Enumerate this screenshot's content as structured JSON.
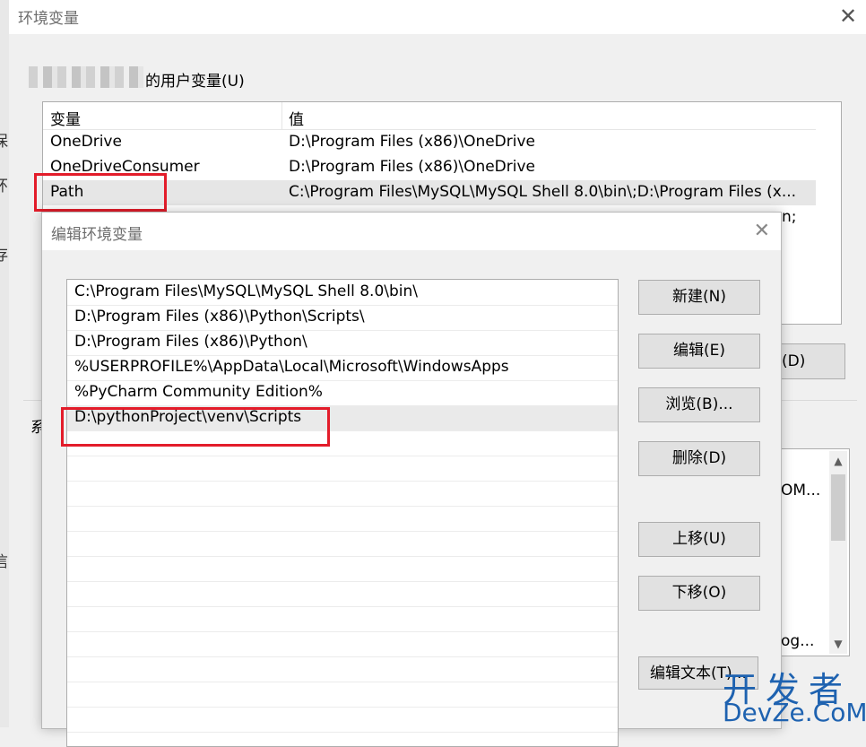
{
  "outer_dialog": {
    "title": "环境变量",
    "close_glyph": "✕",
    "user_vars_label": "的用户变量(U)",
    "columns": {
      "variable": "变量",
      "value": "值"
    },
    "rows": [
      {
        "name": "OneDrive",
        "value": "D:\\Program Files (x86)\\OneDrive"
      },
      {
        "name": "OneDriveConsumer",
        "value": "D:\\Program Files (x86)\\OneDrive"
      },
      {
        "name": "Path",
        "value": "C:\\Program Files\\MySQL\\MySQL Shell 8.0\\bin\\;D:\\Program Files (x..."
      }
    ],
    "partial_row_fragment": "n;",
    "partial_delete_button": "(D)",
    "system_vars_label_fragment": "系",
    "system_list_fragment_1": "OM...",
    "system_list_fragment_2": "og...",
    "left_fragments": [
      "保",
      "环",
      "存",
      "信"
    ]
  },
  "edit_dialog": {
    "title": "编辑环境变量",
    "close_glyph": "✕",
    "entries": [
      "C:\\Program Files\\MySQL\\MySQL Shell 8.0\\bin\\",
      "D:\\Program Files (x86)\\Python\\Scripts\\",
      "D:\\Program Files (x86)\\Python\\",
      "%USERPROFILE%\\AppData\\Local\\Microsoft\\WindowsApps",
      "%PyCharm Community Edition%",
      "D:\\pythonProject\\venv\\Scripts"
    ],
    "buttons": {
      "new": "新建(N)",
      "edit": "编辑(E)",
      "browse": "浏览(B)...",
      "delete": "删除(D)",
      "move_up": "上移(U)",
      "move_down": "下移(O)",
      "edit_text": "编辑文本(T)..."
    }
  },
  "watermark": {
    "line1": "开发者",
    "line2": "DevZe.CoM"
  },
  "colors": {
    "highlight_border": "#e31c2a",
    "watermark": "#1e62b0"
  }
}
